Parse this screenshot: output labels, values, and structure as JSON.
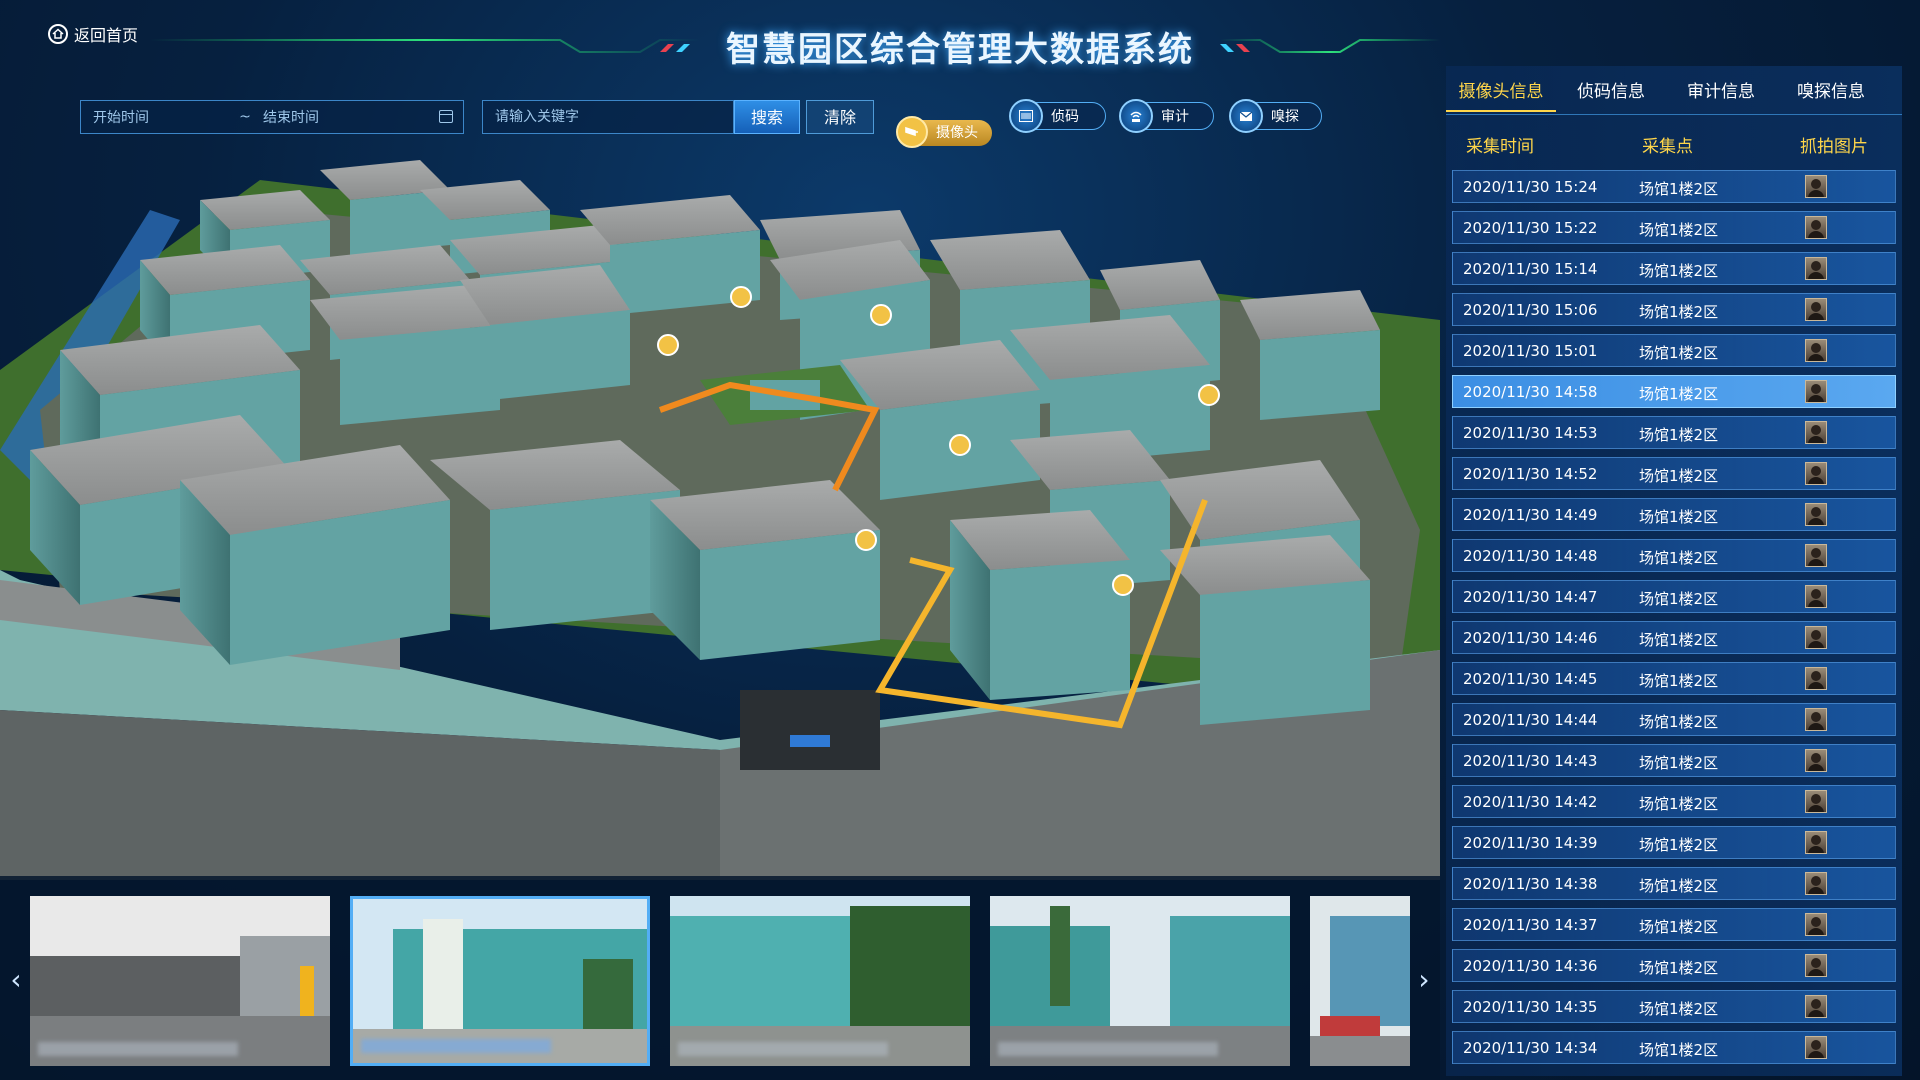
{
  "header": {
    "title": "智慧园区综合管理大数据系统",
    "home_label": "返回首页"
  },
  "toolbar": {
    "start_placeholder": "开始时间",
    "range_separator": "~",
    "end_placeholder": "结束时间",
    "keyword_placeholder": "请输入关键字",
    "search_label": "搜索",
    "clear_label": "清除"
  },
  "layers": {
    "camera": "摄像头",
    "detect": "侦码",
    "audit": "审计",
    "sniff": "嗅探"
  },
  "panel": {
    "tabs": [
      {
        "label": "摄像头信息",
        "active": true
      },
      {
        "label": "侦码信息",
        "active": false
      },
      {
        "label": "审计信息",
        "active": false
      },
      {
        "label": "嗅探信息",
        "active": false
      }
    ],
    "columns": [
      "采集时间",
      "采集点",
      "抓拍图片"
    ],
    "rows": [
      {
        "time": "2020/11/30  15:24",
        "place": "场馆1楼2区"
      },
      {
        "time": "2020/11/30  15:22",
        "place": "场馆1楼2区"
      },
      {
        "time": "2020/11/30  15:14",
        "place": "场馆1楼2区"
      },
      {
        "time": "2020/11/30  15:06",
        "place": "场馆1楼2区"
      },
      {
        "time": "2020/11/30  15:01",
        "place": "场馆1楼2区"
      },
      {
        "time": "2020/11/30  14:58",
        "place": "场馆1楼2区",
        "selected": true
      },
      {
        "time": "2020/11/30  14:53",
        "place": "场馆1楼2区"
      },
      {
        "time": "2020/11/30  14:52",
        "place": "场馆1楼2区"
      },
      {
        "time": "2020/11/30  14:49",
        "place": "场馆1楼2区"
      },
      {
        "time": "2020/11/30  14:48",
        "place": "场馆1楼2区"
      },
      {
        "time": "2020/11/30  14:47",
        "place": "场馆1楼2区"
      },
      {
        "time": "2020/11/30  14:46",
        "place": "场馆1楼2区"
      },
      {
        "time": "2020/11/30  14:45",
        "place": "场馆1楼2区"
      },
      {
        "time": "2020/11/30  14:44",
        "place": "场馆1楼2区"
      },
      {
        "time": "2020/11/30  14:43",
        "place": "场馆1楼2区"
      },
      {
        "time": "2020/11/30  14:42",
        "place": "场馆1楼2区"
      },
      {
        "time": "2020/11/30  14:39",
        "place": "场馆1楼2区"
      },
      {
        "time": "2020/11/30  14:38",
        "place": "场馆1楼2区"
      },
      {
        "time": "2020/11/30  14:37",
        "place": "场馆1楼2区"
      },
      {
        "time": "2020/11/30  14:36",
        "place": "场馆1楼2区"
      },
      {
        "time": "2020/11/30  14:35",
        "place": "场馆1楼2区"
      },
      {
        "time": "2020/11/30  14:34",
        "place": "场馆1楼2区"
      }
    ]
  },
  "colors": {
    "accent_yellow": "#ffd64a",
    "route_orange": "#f08a1e",
    "route_yellow": "#f7c23a",
    "panel_blue": "#1c5faf"
  },
  "icons": {
    "home": "home-icon",
    "calendar": "calendar-icon",
    "camera": "camera-icon",
    "detect": "barcode-icon",
    "audit": "wifi-icon",
    "sniff": "envelope-icon",
    "prev": "chevron-left-icon",
    "next": "chevron-right-icon"
  },
  "thumbnails": {
    "count": 5,
    "selected_index": 1
  }
}
